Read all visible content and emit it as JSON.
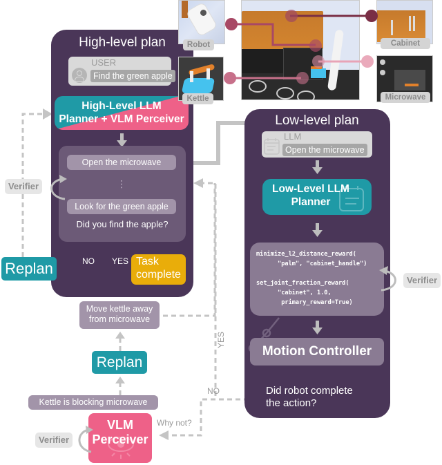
{
  "high_level": {
    "title": "High-level plan",
    "user_label": "USER",
    "user_message": "Find the green apple",
    "planner_label_line1": "High-Level LLM",
    "planner_label_line2": "Planner + VLM Perceiver",
    "steps": [
      "Open the microwave",
      "⋮",
      "Look for the green apple"
    ],
    "question": "Did you find the apple?",
    "no_label": "NO",
    "yes_label": "YES",
    "task_complete_line1": "Task",
    "task_complete_line2": "complete",
    "replan_label": "Replan",
    "verifier_label": "Verifier"
  },
  "low_level": {
    "title": "Low-level plan",
    "llm_label": "LLM",
    "llm_message": "Open the microwave",
    "planner_label_line1": "Low-Level LLM",
    "planner_label_line2": "Planner",
    "code_lines": [
      "minimize_l2_distance_reward(",
      "      \"palm\", \"cabinet_handle\")",
      "",
      "set_joint_fraction_reward(",
      "      \"cabinet\", 1.0,",
      "       primary_reward=True)"
    ],
    "motion_controller_label": "Motion Controller",
    "question_line1": "Did robot complete",
    "question_line2": "the action?",
    "verifier_label": "Verifier"
  },
  "failure_branch": {
    "no_label": "NO",
    "yes_label": "YES",
    "why_not_label": "Why not?",
    "perceiver_line1": "VLM",
    "perceiver_line2": "Perceiver",
    "verifier_label": "Verifier",
    "observation": "Kettle is blocking microwave",
    "replan_label": "Replan",
    "new_step_line1": "Move kettle away",
    "new_step_line2": "from microwave"
  },
  "scene": {
    "labels": {
      "robot": "Robot",
      "kettle": "Kettle",
      "cabinet": "Cabinet",
      "microwave": "Microwave"
    }
  },
  "colors": {
    "panel": "#4a3658",
    "teal": "#1f9aa6",
    "pink": "#ee6188",
    "gold": "#e9ad0a",
    "arrow_gray": "#bdbdbd"
  }
}
